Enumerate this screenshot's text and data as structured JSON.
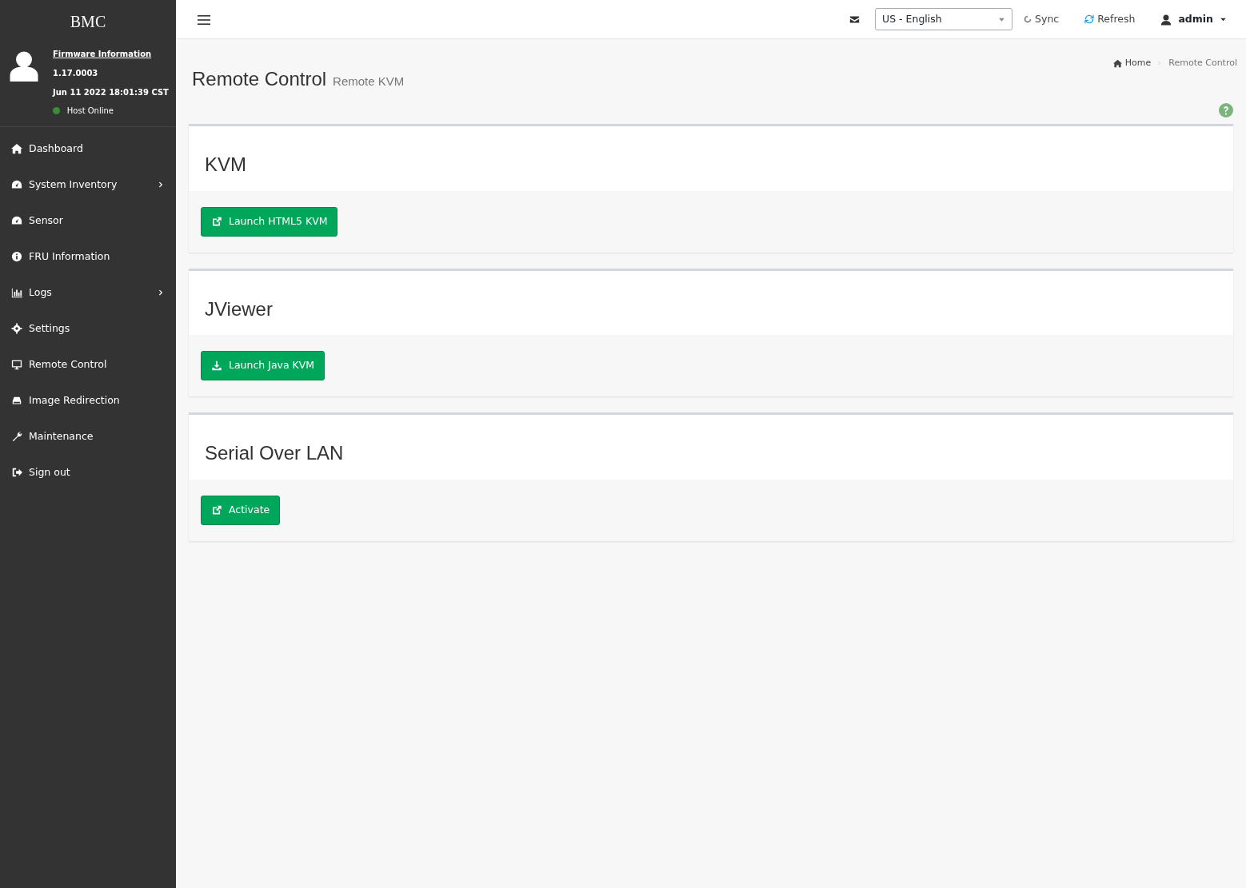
{
  "sidebar": {
    "logo": "BMC",
    "firmware": {
      "link": "Firmware Information",
      "version": "1.17.0003",
      "date": "Jun 11 2022 18:01:39 CST",
      "host": {
        "status": "Host Online",
        "color": "#3c8b3c"
      }
    },
    "items": [
      {
        "label": "Dashboard",
        "expandable": false
      },
      {
        "label": "System Inventory",
        "expandable": true
      },
      {
        "label": "Sensor",
        "expandable": false
      },
      {
        "label": "FRU Information",
        "expandable": false
      },
      {
        "label": "Logs",
        "expandable": true
      },
      {
        "label": "Settings",
        "expandable": false
      },
      {
        "label": "Remote Control",
        "expandable": false
      },
      {
        "label": "Image Redirection",
        "expandable": false
      },
      {
        "label": "Maintenance",
        "expandable": false
      },
      {
        "label": "Sign out",
        "expandable": false
      }
    ]
  },
  "topbar": {
    "language": "US - English",
    "sync": "Sync",
    "refresh": "Refresh",
    "user": "admin"
  },
  "page": {
    "title": "Remote Control",
    "subtitle": "Remote KVM",
    "breadcrumb": [
      "Home",
      "Remote Control"
    ]
  },
  "panels": [
    {
      "title": "KVM",
      "button": "Launch HTML5 KVM"
    },
    {
      "title": "JViewer",
      "button": "Launch Java KVM"
    },
    {
      "title": "Serial Over LAN",
      "button": "Activate"
    }
  ]
}
